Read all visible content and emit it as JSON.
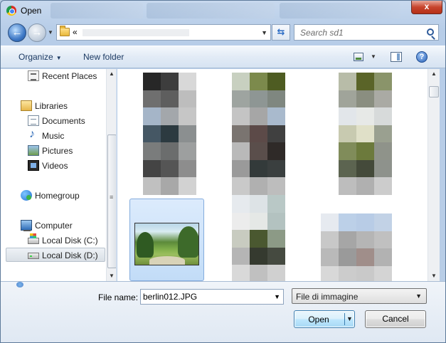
{
  "window": {
    "title": "Open",
    "close_label": "x"
  },
  "address": {
    "chevron": "«",
    "search_placeholder": "Search sd1"
  },
  "toolbar": {
    "organize_label": "Organize",
    "new_folder_label": "New folder",
    "help_label": "?"
  },
  "navigation": {
    "items": [
      {
        "label": "Recent Places",
        "icon": "recent-places-icon"
      },
      {
        "label": "Libraries",
        "icon": "libraries-icon"
      },
      {
        "label": "Documents",
        "icon": "documents-icon"
      },
      {
        "label": "Music",
        "icon": "music-icon"
      },
      {
        "label": "Pictures",
        "icon": "pictures-icon"
      },
      {
        "label": "Videos",
        "icon": "videos-icon"
      },
      {
        "label": "Homegroup",
        "icon": "homegroup-icon"
      },
      {
        "label": "Computer",
        "icon": "computer-icon"
      },
      {
        "label": "Local Disk (C:)",
        "icon": "local-disk-c-icon"
      },
      {
        "label": "Local Disk (D:)",
        "icon": "local-disk-d-icon",
        "selected": true
      }
    ]
  },
  "footer": {
    "file_name_label": "File name:",
    "file_name_value": "berlin012.JPG",
    "file_type_value": "File di immagine",
    "open_label": "Open",
    "cancel_label": "Cancel"
  }
}
